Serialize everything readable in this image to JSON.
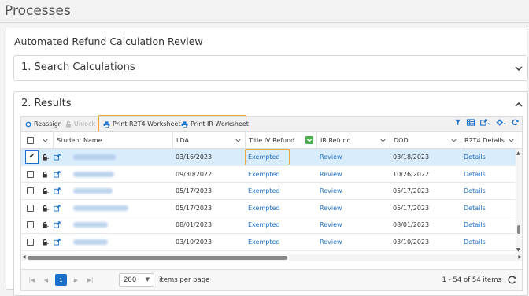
{
  "page": {
    "title": "Processes"
  },
  "review": {
    "heading": "Automated Refund Calculation Review"
  },
  "search_panel": {
    "title": "1. Search Calculations"
  },
  "results_panel": {
    "title": "2. Results"
  },
  "toolbar": {
    "reassign_label": "Reassign",
    "unlock_label": "Unlock",
    "print_r2t4_label": "Print R2T4 Worksheet",
    "print_ir_label": "Print IR Worksheet"
  },
  "columns": {
    "student_name": "Student Name",
    "lda": "LDA",
    "title_iv_refund": "Title IV Refund",
    "ir_refund": "IR Refund",
    "dod": "DOD",
    "r2t4_details": "R2T4 Details"
  },
  "rows": [
    {
      "checked": true,
      "lda": "03/16/2023",
      "title_iv": "Exempted",
      "ir": "Review",
      "dod": "03/18/2023",
      "details": "Details"
    },
    {
      "checked": false,
      "lda": "09/30/2022",
      "title_iv": "Exempted",
      "ir": "Review",
      "dod": "10/26/2022",
      "details": "Details"
    },
    {
      "checked": false,
      "lda": "05/17/2023",
      "title_iv": "Exempted",
      "ir": "Review",
      "dod": "05/17/2023",
      "details": "Details"
    },
    {
      "checked": false,
      "lda": "05/17/2023",
      "title_iv": "Exempted",
      "ir": "Review",
      "dod": "05/17/2023",
      "details": "Details"
    },
    {
      "checked": false,
      "lda": "08/01/2023",
      "title_iv": "Exempted",
      "ir": "Review",
      "dod": "08/01/2023",
      "details": "Details"
    },
    {
      "checked": false,
      "lda": "03/10/2023",
      "title_iv": "Exempted",
      "ir": "Review",
      "dod": "03/10/2023",
      "details": "Details"
    }
  ],
  "pager": {
    "current_page": "1",
    "page_size": "200",
    "items_per_page_label": "items per page",
    "range_info": "1 - 54 of 54 items"
  },
  "colors": {
    "accent": "#1a6fc9",
    "highlight_border": "#e8a93a",
    "selected_row": "#d9ecfb"
  },
  "icons": [
    "reassign-icon",
    "unlock-icon",
    "printer-icon",
    "filter-icon",
    "columns-icon",
    "export-icon",
    "settings-icon",
    "refresh-icon",
    "lock-icon",
    "external-link-icon",
    "chevron-down-icon",
    "chevron-up-icon"
  ]
}
